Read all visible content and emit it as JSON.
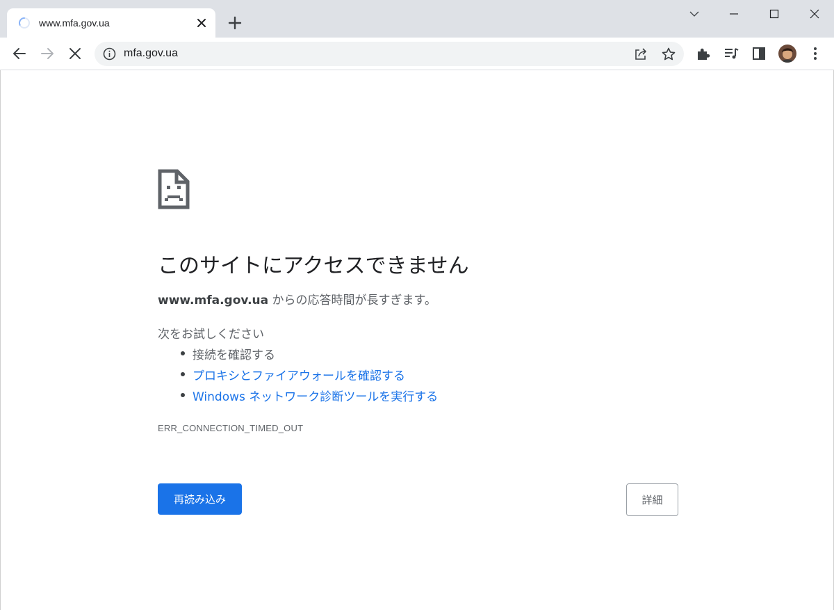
{
  "browser": {
    "tab": {
      "title": "www.mfa.gov.ua",
      "loading_icon": "spinner-icon",
      "close_icon": "close-icon"
    },
    "new_tab_icon": "plus-icon",
    "window_controls": [
      "chevron-down-icon",
      "minimize-icon",
      "maximize-icon",
      "close-icon"
    ],
    "toolbar": {
      "back_icon": "back-arrow-icon",
      "forward_icon": "forward-arrow-icon",
      "stop_icon": "stop-icon",
      "omnibox": {
        "info_icon": "info-icon",
        "url": "mfa.gov.ua",
        "share_icon": "share-icon",
        "bookmark_icon": "star-icon"
      },
      "extensions_icon": "puzzle-icon",
      "media_icon": "media-queue-icon",
      "side_panel_icon": "side-panel-icon",
      "profile": "avatar",
      "menu_icon": "kebab-menu-icon"
    }
  },
  "error_page": {
    "icon": "sad-page-icon",
    "heading": "このサイトにアクセスできません",
    "summary_host": "www.mfa.gov.ua",
    "summary_rest": " からの応答時間が長すぎます。",
    "try_label": "次をお試しください",
    "suggestions": [
      {
        "text": "接続を確認する",
        "is_link": false
      },
      {
        "text": "プロキシとファイアウォールを確認する",
        "is_link": true
      },
      {
        "text": "Windows ネットワーク診断ツールを実行する",
        "is_link": true
      }
    ],
    "error_code": "ERR_CONNECTION_TIMED_OUT",
    "reload_label": "再読み込み",
    "details_label": "詳細"
  },
  "colors": {
    "accent": "#1a73e8",
    "tabstrip": "#dee1e6",
    "omnibox": "#f1f3f4",
    "text_primary": "#202124",
    "text_secondary": "#5f6368"
  }
}
